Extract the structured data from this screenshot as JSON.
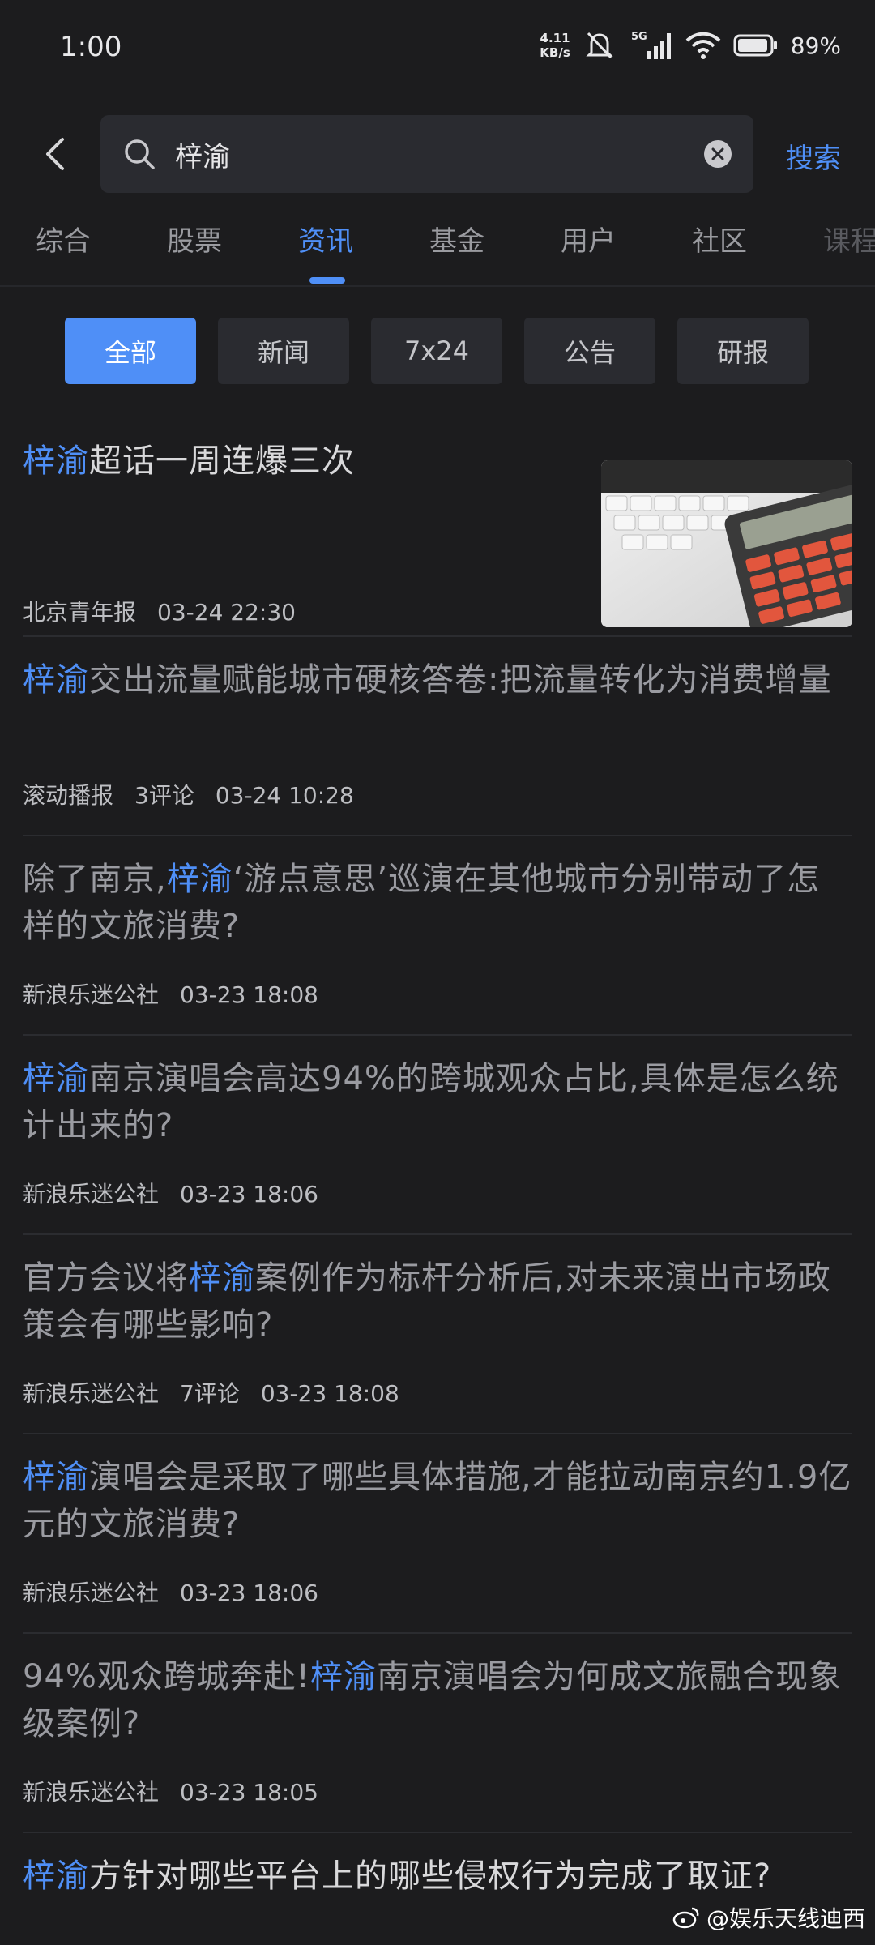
{
  "status": {
    "time": "1:00",
    "net_speed_value": "4.11",
    "net_speed_unit": "KB/s",
    "network": "5G",
    "battery": "89%"
  },
  "search": {
    "query": "梓渝",
    "button": "搜索"
  },
  "tabs": [
    "综合",
    "股票",
    "资讯",
    "基金",
    "用户",
    "社区",
    "课程"
  ],
  "active_tab": "资讯",
  "filters": [
    "全部",
    "新闻",
    "7x24",
    "公告",
    "研报"
  ],
  "active_filter": "全部",
  "news": [
    {
      "pre": "",
      "hl": "梓渝",
      "post": "超话一周连爆三次",
      "source": "北京青年报",
      "comments": "",
      "time": "03-24 22:30",
      "has_thumb": true
    },
    {
      "pre": "",
      "hl": "梓渝",
      "post": "交出流量赋能城市硬核答卷:把流量转化为消费增量",
      "source": "滚动播报",
      "comments": "3评论",
      "time": "03-24 10:28"
    },
    {
      "pre": "除了南京,",
      "hl": "梓渝",
      "post": "‘游点意思’巡演在其他城市分别带动了怎样的文旅消费?",
      "source": "新浪乐迷公社",
      "comments": "",
      "time": "03-23 18:08"
    },
    {
      "pre": "",
      "hl": "梓渝",
      "post": "南京演唱会高达94%的跨城观众占比,具体是怎么统计出来的?",
      "source": "新浪乐迷公社",
      "comments": "",
      "time": "03-23 18:06"
    },
    {
      "pre": "官方会议将",
      "hl": "梓渝",
      "post": "案例作为标杆分析后,对未来演出市场政策会有哪些影响?",
      "source": "新浪乐迷公社",
      "comments": "7评论",
      "time": "03-23 18:08"
    },
    {
      "pre": "",
      "hl": "梓渝",
      "post": "演唱会是采取了哪些具体措施,才能拉动南京约1.9亿元的文旅消费?",
      "source": "新浪乐迷公社",
      "comments": "",
      "time": "03-23 18:06"
    },
    {
      "pre": "94%观众跨城奔赴!",
      "hl": "梓渝",
      "post": "南京演唱会为何成文旅融合现象级案例?",
      "source": "新浪乐迷公社",
      "comments": "",
      "time": "03-23 18:05"
    },
    {
      "pre": "",
      "hl": "梓渝",
      "post": "方针对哪些平台上的哪些侵权行为完成了取证?",
      "source": "",
      "comments": "",
      "time": ""
    }
  ],
  "watermark": "@娱乐天线迪西",
  "colors": {
    "accent": "#4f8ff7",
    "background": "#1c1c1e",
    "chip": "#2a2b30"
  }
}
